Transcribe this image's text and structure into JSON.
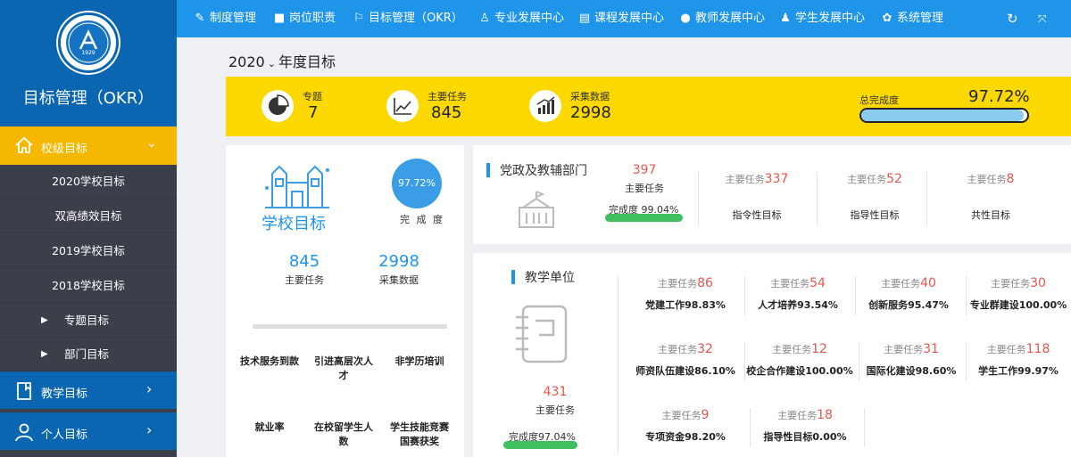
{
  "sidebar": {
    "logo_year": "1929",
    "title": "目标管理（OKR）",
    "active_menu": "校级目标",
    "submenu": [
      "2020学校目标",
      "双高绩效目标",
      "2019学校目标",
      "2018学校目标"
    ],
    "tree_items": [
      "专题目标",
      "部门目标"
    ],
    "menus": [
      "教学目标",
      "个人目标"
    ]
  },
  "topnav": {
    "items": [
      "制度管理",
      "岗位职责",
      "目标管理（OKR）",
      "专业发展中心",
      "课程发展中心",
      "教师发展中心",
      "学生发展中心",
      "系统管理"
    ],
    "icons": [
      "wrench-icon",
      "briefcase-icon",
      "flag-icon",
      "award-icon",
      "book-icon",
      "user-icon",
      "student-icon",
      "gear-icon"
    ]
  },
  "year": {
    "value": "2020",
    "suffix": "年度目标"
  },
  "stats": {
    "topic_label": "专题",
    "topic_value": "7",
    "task_label": "主要任务",
    "task_value": "845",
    "data_label": "采集数据",
    "data_value": "2998",
    "total_label": "总完成度",
    "total_value": "97.72%",
    "total_progress": 0.9772
  },
  "school": {
    "title": "学校目标",
    "percent": "97.72%",
    "percent_caption": "完 成 度",
    "tasks_value": "845",
    "tasks_label": "主要任务",
    "data_value": "2998",
    "data_label": "采集数据",
    "kpis": [
      "技术服务到款",
      "引进高层次人才",
      "非学历培训",
      "就业率",
      "在校留学生人数",
      "学生技能竞赛国赛获奖"
    ]
  },
  "party": {
    "title": "党政及教辅部门",
    "count": "397",
    "count_label": "主要任务",
    "completion_label": "完成度",
    "completion_value": "99.04%",
    "completion_progress": 0.9904,
    "cols": [
      {
        "label": "主要任务",
        "num": "337",
        "caption": "指令性目标"
      },
      {
        "label": "主要任务",
        "num": "52",
        "caption": "指导性目标"
      },
      {
        "label": "主要任务",
        "num": "8",
        "caption": "共性目标"
      }
    ]
  },
  "teaching": {
    "title": "教学单位",
    "count": "431",
    "count_label": "主要任务",
    "completion_label": "完成度",
    "completion_value": "97.04%",
    "completion_progress": 0.9704,
    "rows": [
      [
        {
          "label": "主要任务",
          "num": "86",
          "caption": "党建工作98.83%"
        },
        {
          "label": "主要任务",
          "num": "54",
          "caption": "人才培养93.54%"
        },
        {
          "label": "主要任务",
          "num": "40",
          "caption": "创新服务95.47%"
        },
        {
          "label": "主要任务",
          "num": "30",
          "caption": "专业群建设100.00%"
        }
      ],
      [
        {
          "label": "主要任务",
          "num": "32",
          "caption": "师资队伍建设86.10%"
        },
        {
          "label": "主要任务",
          "num": "12",
          "caption": "校企合作建设100.00%"
        },
        {
          "label": "主要任务",
          "num": "31",
          "caption": "国际化建设98.60%"
        },
        {
          "label": "主要任务",
          "num": "118",
          "caption": "学生工作99.97%"
        }
      ],
      [
        {
          "label": "主要任务",
          "num": "9",
          "caption": "专项资金98.20%"
        },
        {
          "label": "主要任务",
          "num": "18",
          "caption": "指导性目标0.00%"
        }
      ]
    ]
  }
}
